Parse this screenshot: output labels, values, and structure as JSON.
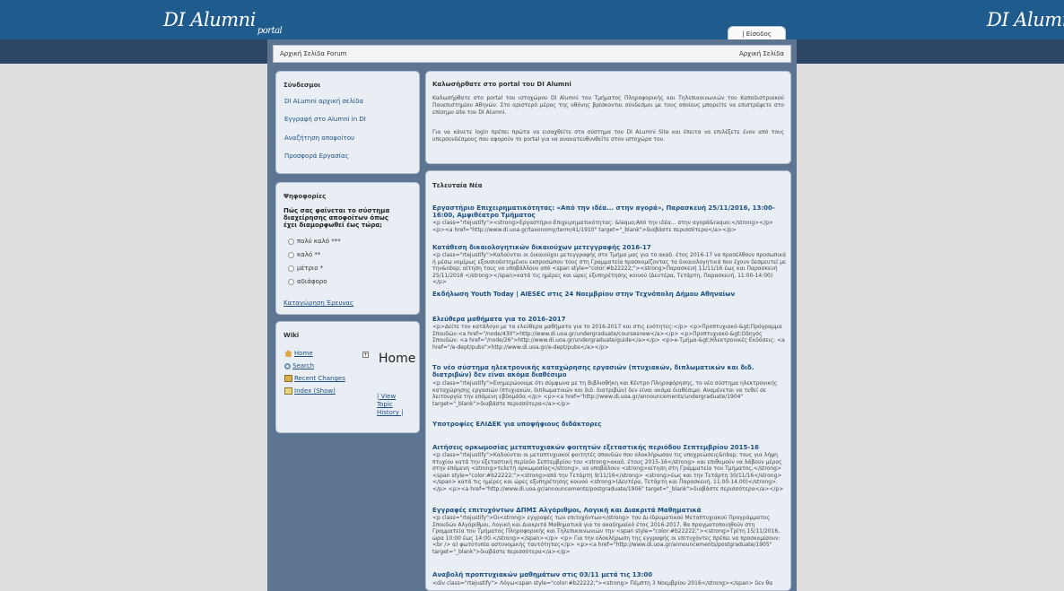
{
  "header": {
    "logo_main": "DI Alumni",
    "logo_sub": "portal",
    "logo_repeat": "DI Alumn",
    "login_tab": "| Είσοδος"
  },
  "nav": {
    "left": "Αρχική Σελίδα  Forum",
    "right": "Αρχική Σελίδα"
  },
  "links_box": {
    "title": "Σύνδεσμοι",
    "items": [
      "DI ALumni αρχική σελίδα",
      "Εγγραφή στο Alumni in DI",
      "Αναζήτηση αποφοίτου",
      "Προσφορά Εργασίας"
    ]
  },
  "polls_box": {
    "title": "Ψηφοφορίες",
    "question": "Πώς σας φαίνεται το σύστημα διαχείρησης αποφοίτων όπως έχει διαμορφωθεί έως τώρα;",
    "options": [
      "πολύ καλό ***",
      "καλό **",
      "μέτριο *",
      "αδιάφορο"
    ],
    "archive_link": "Καταγώρηση Έρευνας"
  },
  "wiki_box": {
    "title": "Wiki",
    "items": [
      "Home",
      "Search",
      "Recent Changes",
      "Index (Show)"
    ],
    "page_title": "Home",
    "view": "| View",
    "topic": "Topic",
    "history": "History |"
  },
  "welcome": {
    "title": "Καλωσήρθατε στο portal του DI Alumni",
    "p1": "Καλωσήρθατε στο portal του ιστοχώρου DI Alumni του Τμήματος Πληροφορικής και Τηλεπικοινωνιών του Καποδιστριακού Πανεπιστημίου Αθηνών. Στο αριστερό μέρος της οθόνης βρίσκονται σύνδεσμοι με τους οποίους μπορείτε να επιστρέψετε στο επίσημο site του DI Alumni.",
    "p2": "Για να κάνετε login πρέπει πρώτα να εισαχθείτε στο σύστημα του DI ALumni Site και έπειτα να επιλέξετε ένον από τους υπερσυνδέσμους που αφορούν το portal για να ανακατευθυνθείτε στον ιστοχώρο του."
  },
  "news": {
    "title": "Τελευταία Νέα",
    "items": [
      {
        "title": "Εργαστήριο Επιχειρηματικότητας: «Από την ιδέα... στην αγορά», Παρασκευή 25/11/2016, 13:00-16:00, Αμφιθέατρο Τμήματος",
        "body": "<p class=\"rtejustify\"><strong>Εργαστήριο Επιχειρηματικότητας: &laquo;Από την ιδέα... στην αγορά&raquo;</strong></p> <p><a href=\"http://www.di.uoa.gr/taxonomy/term/41/1910\" target=\"_blank\">διαβάστε περισσότερα</a></p>"
      },
      {
        "title": "Κατάθεση δικαιολογητικών δικαιούχων μετεγγραφής 2016-17",
        "body": "<p class=\"rtejustify\">Καλούνται οι δικαιούχοι μετεγγραφής στο Τμήμα μας για το ακαδ. έτος 2016-17 να προσέλθουν προσωπικά ή μέσω νομίμως εξουσιοδοτημένου εκπροσώπου τους στη Γραμματεία προσκομίζοντας τα δικαιολογητικά που έχουν δεσμευτεί με την&nbsp; αίτηση τους να υποβάλλουν από <span style=\"color:#b22222;\"><strong>Παρασκευή 11/11/16 έως και Παρασκευή 25/11/2016 </strong></span>κατά τις ημέρες και ώρες εξυπηρέτησης κοινού (Δευτέρα, Τετάρτη, Παρασκευή, 11:00-14:00)</p>"
      },
      {
        "title": "Εκδήλωση Youth Today | AIESEC στις 24 Νοεμβρίου στην Τεχνόπολη Δήμου Αθηναίων",
        "body": ""
      },
      {
        "title": "Ελεύθερα μαθήματα για το 2016-2017",
        "body": "<p>Δείτε τον κατάλογο με τα ελεύθερα μαθήματα για το 2016-2017 και στις ενότητες:</p> <p>Προπτυχιακό-&gt;Πρόγραμμα Σπουδών:<a href=\"/node/430\">http://www.di.uoa.gr/undergraduate/coursesnew</a></p> <p>Προπτυχιακό-&gt;Οδηγός Σπουδών: <a href=\"/node/26\">http://www.di.uoa.gr/undergraduate/guide</a></p> <p>e-Τμήμα-&gt;Ηλεκτρονικές Εκδόσεις: <a href=\"/e-dept/pubs\">http://www.di.uoa.gr/e-dept/pubs</a></p>"
      },
      {
        "title": "Το νέο σύστημα ηλεκτρονικής καταχώρησης εργασιών (πτυχιακών, διπλωματικών και διδ. διατριβών) δεν είναι ακόμα διαθέσιμο",
        "body": "<p class=\"rtejustify\">Ενημερώνουμε ότι σύμφωνα με τη Βιβλιοθήκη και Κέντρο Πληροφόρησης, το νέο σύστημα ηλεκτρονικής καταχώρησης εργασιών (πτυχιακών, διπλωματικών και διδ. διατριβών) δεν είναι ακόμα διαθέσιμο. Αναμένεται να τεθεί σε λειτουργία την επόμενη εβδομάδα.</p> <p><a href=\"http://www.di.uoa.gr/announcements/undergraduate/1904\" target=\"_blank\">διαβάστε περισσότερα</a></p>"
      },
      {
        "title": "Υποτροφίες ΕΛΙΔΕΚ για υποψήφιους διδάκτορες",
        "body": ""
      },
      {
        "title": "Αιτήσεις ορκωμοσίας μεταπτυχιακών φοιτητών εξεταστικής περιόδου Σεπτεμβρίου 2015-16",
        "body": "<p class=\"rtejustify\">Καλούνται οι μεταπτυχιακοί φοιτητές σπουδών που ολοκλήρωσαν τις υποχρεώσεις&nbsp; τους για λήψη πτυχίου κατά την εξεταστική περίοδο Σεπτεμβρίου του <strong>ακαδ. έτους 2015-16</strong> και επιθυμούν να λάβουν μέρος στην επόμενη <strong>τελετή ορκωμοσίας</strong>, να υποβάλουν <strong>αίτηση στη Γραμματεία του Τμήματος,</strong> <span style=\"color:#b22222;\"><strong>από την Τετάρτη 9/11/16</strong> <strong>έως και την Τετάρτη 30/11/16</strong></span> κατά τις ημέρες και ώρες εξυπηρέτησης κοινού <strong>(Δευτέρα, Τετάρτη και Παρασκευή, 11.00-14.00)</strong>.</p> <p><a href=\"http://www.di.uoa.gr/announcements/postgraduate/1906\" target=\"_blank\">διαβάστε περισσότερα</a></p>"
      },
      {
        "title": "Εγγραφές επιτυχόντων ΔΠΜΣ Αλγόριθμοι, Λογική και Διακριτά Μαθηματικά",
        "body": "<p class=\"rtejustify\">Οι<strong> εγγραφές των επιτυχόντων</strong> του Δι-Ιδρυματικού Μεταπτυχιακού Προγράμματος Σπουδών Αλγόριθμοι, Λογική και Διακριτά Μαθηματικά για το ακαδημαϊκό έτος 2016-2017, θα πραγματοποιηθούν στη Γραμματεία του Τμήματος Πληροφορικής και Τηλεπικοινωνιών την <span style=\"color:#b22222;\"><strong>Τρίτη 15/11/2016, ώρα 10:00 έως 14:00.</strong></span></p> <p> Για την ολοκλήρωση της εγγραφής οι επιτυχόντες πρέπει να προσκομίσουν:<br /> α) φωτοτυπία αστυνομικής ταυτότητας</p> <p><a href=\"http://www.di.uoa.gr/announcements/postgraduate/1905\" target=\"_blank\">διαβάστε περισσότερα</a></p>"
      },
      {
        "title": "Αναβολή προπτυχιακών μαθημάτων στις 03/11 μετά τις 13:00",
        "body": "<div class=\"rtejustify\"> Λόγω<span style=\"color:#b22222;\"><strong> Πέμπτη 3 Νοεμβρίου 2016</strong></span> δεν θα"
      }
    ]
  }
}
